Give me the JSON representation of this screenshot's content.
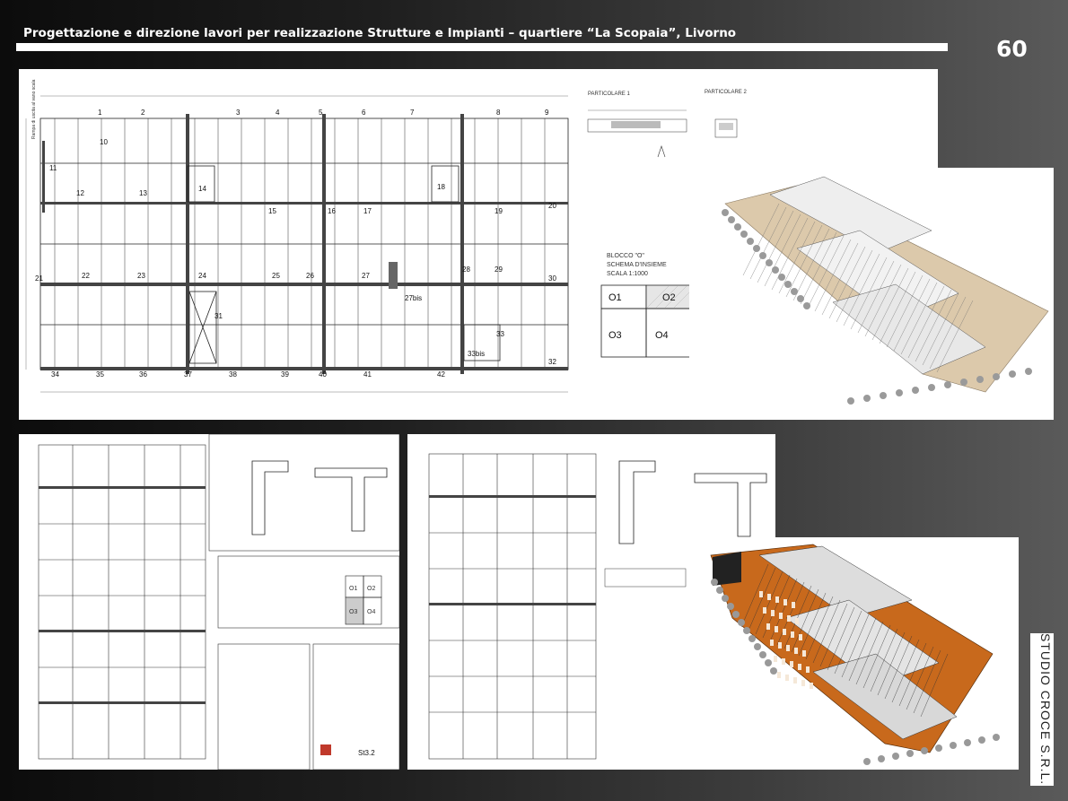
{
  "header": {
    "title": "Progettazione e direzione lavori per realizzazione Strutture e Impianti – quartiere “La Scopaia”, Livorno",
    "page_number": "60"
  },
  "footer": {
    "studio_name": "STUDIO CROCE S.R.L."
  },
  "plan_top": {
    "column_labels": [
      "1",
      "2",
      "3",
      "4",
      "5",
      "6",
      "7",
      "8",
      "9"
    ],
    "bay_labels": [
      "10",
      "11",
      "12",
      "13",
      "14",
      "15",
      "16",
      "17",
      "18",
      "19",
      "20",
      "21",
      "22",
      "23",
      "24",
      "25",
      "26",
      "27",
      "27bis",
      "28",
      "29",
      "30",
      "31",
      "32",
      "33",
      "33bis",
      "34",
      "35",
      "36",
      "37",
      "38",
      "39",
      "40",
      "41",
      "42"
    ],
    "note_vertical": "Rampa di uscita al vano scala"
  },
  "details_top": {
    "detail1_title": "PARTICOLARE 1",
    "detail2_title": "PARTICOLARE 2",
    "schema_title_1": "BLOCCO \"O\"",
    "schema_title_2": "SCHEMA D'INSIEME",
    "schema_scale": "SCALA 1:1000",
    "blocks": [
      "O1",
      "O2",
      "O3",
      "O4"
    ]
  },
  "sheet_left": {
    "schema_blocks": [
      "O1",
      "O2",
      "O3",
      "O4"
    ],
    "sheet_code": "St3.2"
  },
  "colors": {
    "background": "#1e1e1e",
    "panel": "#ffffff",
    "render_brown": "#c8691c",
    "render_beige": "#dcc9ab"
  },
  "icons": [
    "building-render-beige",
    "building-render-brown",
    "tree-icon"
  ]
}
